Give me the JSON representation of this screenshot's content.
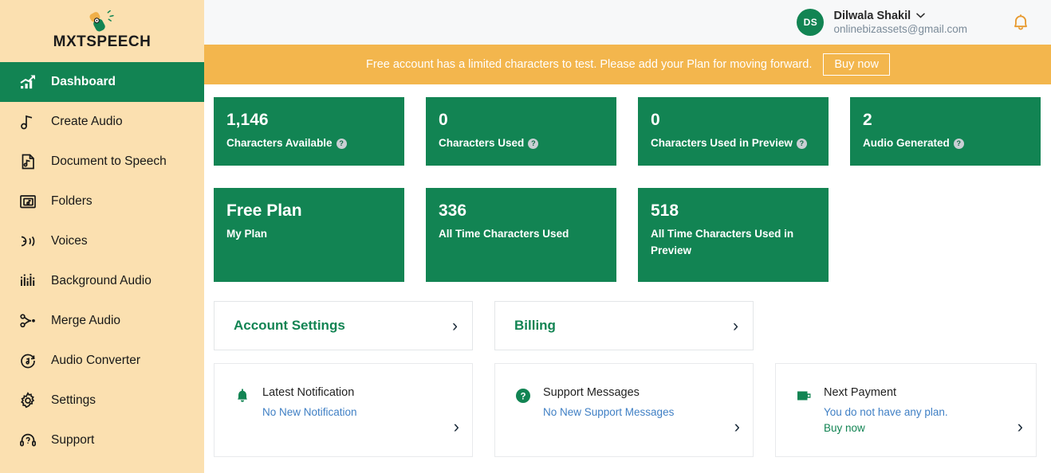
{
  "brand": {
    "name": "MXTSPEECH",
    "logo_icon": "microphone-icon"
  },
  "sidebar": {
    "items": [
      {
        "label": "Dashboard",
        "icon": "chart-growth-icon",
        "active": true
      },
      {
        "label": "Create Audio",
        "icon": "music-note-icon",
        "active": false
      },
      {
        "label": "Document to Speech",
        "icon": "document-music-icon",
        "active": false
      },
      {
        "label": "Folders",
        "icon": "folder-music-icon",
        "active": false
      },
      {
        "label": "Voices",
        "icon": "speaking-head-icon",
        "active": false
      },
      {
        "label": "Background Audio",
        "icon": "equalizer-icon",
        "active": false
      },
      {
        "label": "Merge Audio",
        "icon": "merge-icon",
        "active": false
      },
      {
        "label": "Audio Converter",
        "icon": "audio-convert-icon",
        "active": false
      },
      {
        "label": "Settings",
        "icon": "gear-icon",
        "active": false
      },
      {
        "label": "Support",
        "icon": "headset-icon",
        "active": false
      }
    ]
  },
  "topbar": {
    "avatar_initials": "DS",
    "user_name": "Dilwala Shakil",
    "user_email": "onlinebizassets@gmail.com",
    "chevron_icon": "chevron-down-icon",
    "bell_icon": "bell-icon"
  },
  "banner": {
    "message": "Free account has a limited characters to test. Please add your Plan for moving forward.",
    "button_label": "Buy now",
    "bg_color": "#f3b64d"
  },
  "stats_row1": [
    {
      "value": "1,146",
      "label": "Characters Available",
      "help": "?"
    },
    {
      "value": "0",
      "label": "Characters Used",
      "help": "?"
    },
    {
      "value": "0",
      "label": "Characters Used in Preview",
      "help": "?"
    },
    {
      "value": "2",
      "label": "Audio Generated",
      "help": "?"
    }
  ],
  "stats_row2": [
    {
      "value": "Free Plan",
      "label": "My Plan"
    },
    {
      "value": "336",
      "label": "All Time Characters Used"
    },
    {
      "value": "518",
      "label": "All Time Characters Used in Preview"
    }
  ],
  "link_cards": [
    {
      "title": "Account Settings",
      "chevron": "›"
    },
    {
      "title": "Billing",
      "chevron": "›"
    }
  ],
  "info_cards": [
    {
      "icon": "bell-icon",
      "title": "Latest Notification",
      "subtitle": "No New Notification",
      "subtitle_link": "",
      "chevron": "›"
    },
    {
      "icon": "question-circle-icon",
      "title": "Support Messages",
      "subtitle": "No New Support Messages",
      "subtitle_link": "",
      "chevron": "›"
    },
    {
      "icon": "wallet-icon",
      "title": "Next Payment",
      "subtitle": "You do not have any plan. ",
      "subtitle_link": "Buy now",
      "chevron": "›"
    }
  ],
  "colors": {
    "brand_green": "#128453",
    "sidebar_bg": "#fbe0b0",
    "banner_orange": "#f3b64d",
    "bell_orange": "#e89a2e",
    "link_blue": "#3f7fc4",
    "topbar_bg": "#f7f8f9"
  }
}
